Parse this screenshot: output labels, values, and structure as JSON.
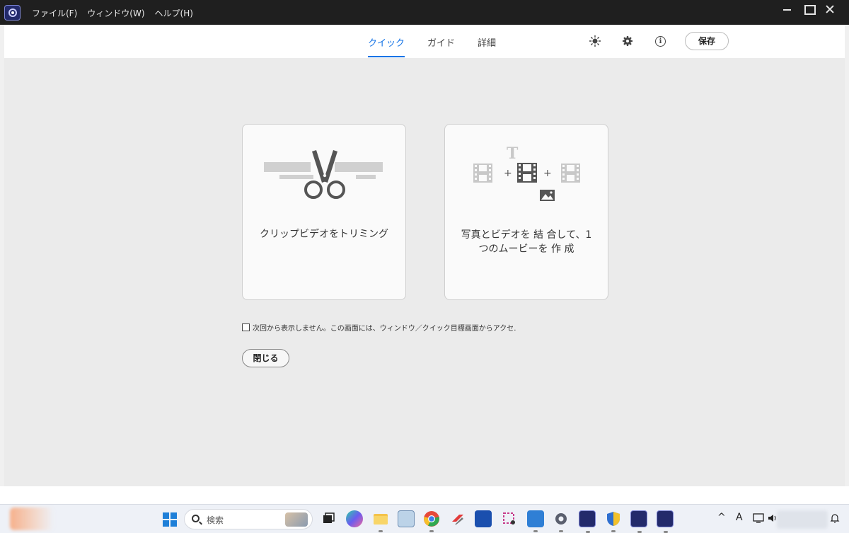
{
  "menu": {
    "items": [
      "ファイル(F)",
      "ウィンドウ(W)",
      "ヘルプ(H)"
    ]
  },
  "header": {
    "tabs": [
      {
        "label": "クイック",
        "active": true
      },
      {
        "label": "ガイド",
        "active": false
      },
      {
        "label": "詳細",
        "active": false
      }
    ],
    "save_label": "保存"
  },
  "cards": {
    "trim": {
      "label": "クリップビデオをトリミング",
      "icon": "scissors-icon"
    },
    "combine": {
      "label_line1": "写真とビデオを 結 合して、1",
      "label_line2": "つのムービーを 作 成",
      "icon": "film-combine-icon",
      "glyph_title": "T",
      "glyph_plus": "+"
    }
  },
  "checkbox_label": "次回から表示しません。この画面には、ウィンドウ／クイック目標画面からアクセ.",
  "close_label": "閉じる",
  "taskbar": {
    "search_placeholder": "検索",
    "tray": {
      "chevron": "^",
      "ime": "A"
    }
  },
  "colors": {
    "accent": "#1473e6",
    "titlebar": "#1f1f1f",
    "main_bg": "#ebebeb"
  }
}
